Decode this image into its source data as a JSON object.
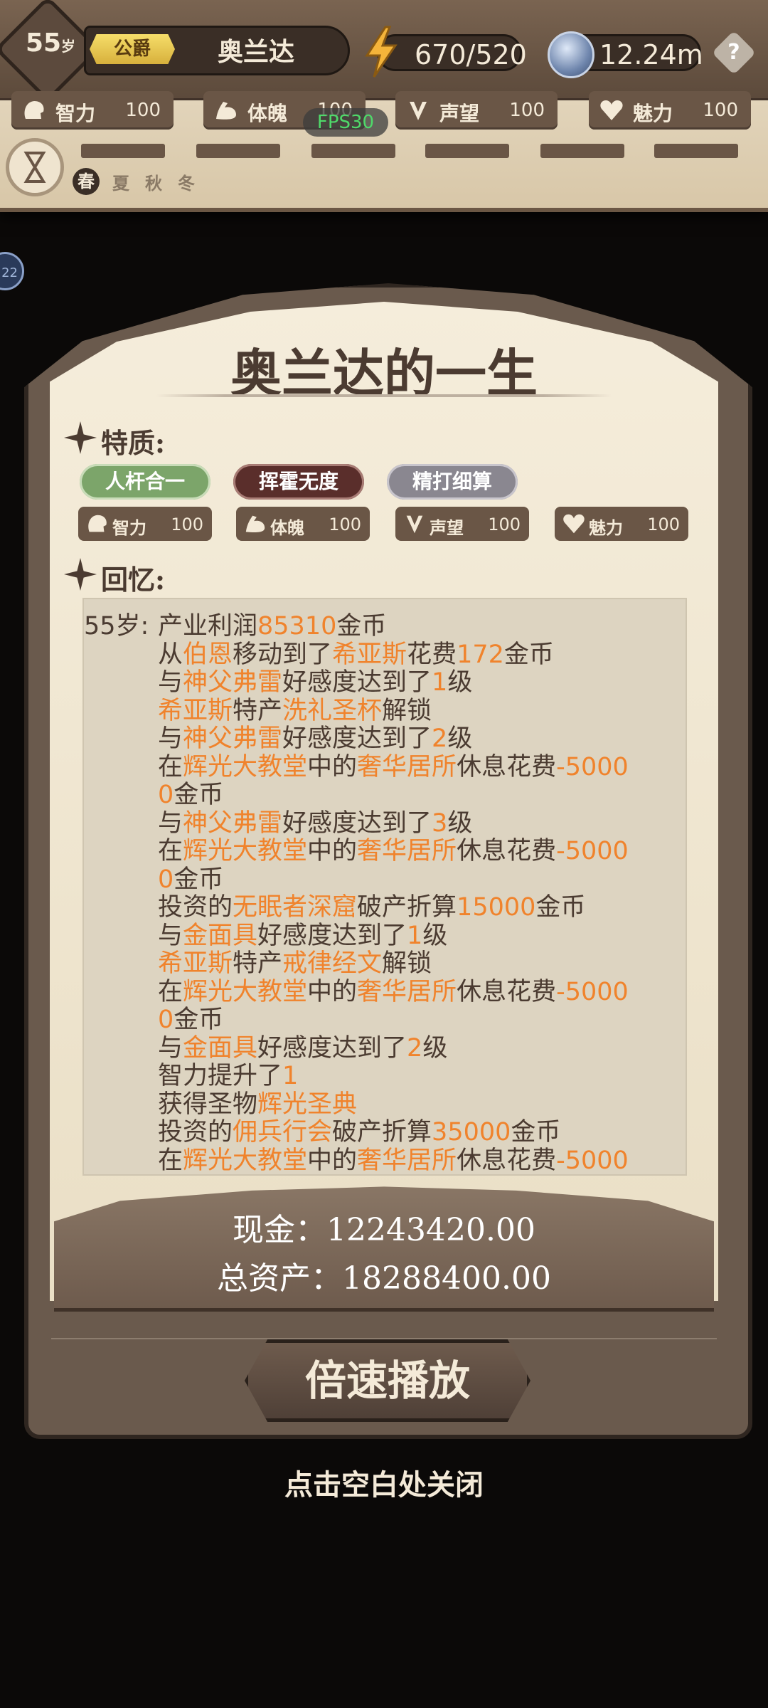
{
  "header": {
    "age": "55",
    "age_unit": "岁",
    "title": "公爵",
    "name": "奥兰达",
    "energy": "670/520",
    "currency": "12.24m",
    "help": "?",
    "fps": "FPS30",
    "stats": [
      {
        "label": "智力",
        "value": "100",
        "icon": "brain-icon"
      },
      {
        "label": "体魄",
        "value": "100",
        "icon": "muscle-icon"
      },
      {
        "label": "声望",
        "value": "100",
        "icon": "laurel-icon"
      },
      {
        "label": "魅力",
        "value": "100",
        "icon": "heart-icon"
      }
    ],
    "seasons": [
      "春",
      "夏",
      "秋",
      "冬"
    ],
    "side_tab": "22"
  },
  "modal": {
    "title": "奥兰达的一生",
    "traits_label": "特质:",
    "traits": [
      {
        "label": "人杆合一",
        "color": "#7ca56a"
      },
      {
        "label": "挥霍无度",
        "color": "#5a2e2b"
      },
      {
        "label": "精打细算",
        "color": "#8a8790"
      }
    ],
    "stats": [
      {
        "label": "智力",
        "value": "100"
      },
      {
        "label": "体魄",
        "value": "100"
      },
      {
        "label": "声望",
        "value": "100"
      },
      {
        "label": "魅力",
        "value": "100"
      }
    ],
    "memories_label": "回忆:",
    "log": [
      {
        "age": "55岁:",
        "parts": [
          [
            "产业利润",
            0
          ],
          [
            "85310",
            1
          ],
          [
            "金币",
            0
          ]
        ]
      },
      {
        "parts": [
          [
            "从",
            0
          ],
          [
            "伯恩",
            1
          ],
          [
            "移动到了",
            0
          ],
          [
            "希亚斯",
            1
          ],
          [
            "花费",
            0
          ],
          [
            "172",
            1
          ],
          [
            "金币",
            0
          ]
        ]
      },
      {
        "parts": [
          [
            "与",
            0
          ],
          [
            "神父弗雷",
            1
          ],
          [
            "好感度达到了",
            0
          ],
          [
            "1",
            1
          ],
          [
            "级",
            0
          ]
        ]
      },
      {
        "parts": [
          [
            "希亚斯",
            1
          ],
          [
            "特产",
            0
          ],
          [
            "洗礼圣杯",
            1
          ],
          [
            "解锁",
            0
          ]
        ]
      },
      {
        "parts": [
          [
            "与",
            0
          ],
          [
            "神父弗雷",
            1
          ],
          [
            "好感度达到了",
            0
          ],
          [
            "2",
            1
          ],
          [
            "级",
            0
          ]
        ]
      },
      {
        "parts": [
          [
            "在",
            0
          ],
          [
            "辉光大教堂",
            1
          ],
          [
            "中的",
            0
          ],
          [
            "奢华居所",
            1
          ],
          [
            "休息花费",
            0
          ],
          [
            "-5000",
            1
          ]
        ]
      },
      {
        "parts": [
          [
            "0",
            1
          ],
          [
            "金币",
            0
          ]
        ]
      },
      {
        "parts": [
          [
            "与",
            0
          ],
          [
            "神父弗雷",
            1
          ],
          [
            "好感度达到了",
            0
          ],
          [
            "3",
            1
          ],
          [
            "级",
            0
          ]
        ]
      },
      {
        "parts": [
          [
            "在",
            0
          ],
          [
            "辉光大教堂",
            1
          ],
          [
            "中的",
            0
          ],
          [
            "奢华居所",
            1
          ],
          [
            "休息花费",
            0
          ],
          [
            "-5000",
            1
          ]
        ]
      },
      {
        "parts": [
          [
            "0",
            1
          ],
          [
            "金币",
            0
          ]
        ]
      },
      {
        "parts": [
          [
            "投资的",
            0
          ],
          [
            "无眠者深窟",
            1
          ],
          [
            "破产折算",
            0
          ],
          [
            "15000",
            1
          ],
          [
            "金币",
            0
          ]
        ]
      },
      {
        "parts": [
          [
            "与",
            0
          ],
          [
            "金面具",
            1
          ],
          [
            "好感度达到了",
            0
          ],
          [
            "1",
            1
          ],
          [
            "级",
            0
          ]
        ]
      },
      {
        "parts": [
          [
            "希亚斯",
            1
          ],
          [
            "特产",
            0
          ],
          [
            "戒律经文",
            1
          ],
          [
            "解锁",
            0
          ]
        ]
      },
      {
        "parts": [
          [
            "在",
            0
          ],
          [
            "辉光大教堂",
            1
          ],
          [
            "中的",
            0
          ],
          [
            "奢华居所",
            1
          ],
          [
            "休息花费",
            0
          ],
          [
            "-5000",
            1
          ]
        ]
      },
      {
        "parts": [
          [
            "0",
            1
          ],
          [
            "金币",
            0
          ]
        ]
      },
      {
        "parts": [
          [
            "与",
            0
          ],
          [
            "金面具",
            1
          ],
          [
            "好感度达到了",
            0
          ],
          [
            "2",
            1
          ],
          [
            "级",
            0
          ]
        ]
      },
      {
        "parts": [
          [
            "智力提升了",
            0
          ],
          [
            "1",
            1
          ]
        ]
      },
      {
        "parts": [
          [
            "获得圣物",
            0
          ],
          [
            "辉光圣典",
            1
          ]
        ]
      },
      {
        "parts": [
          [
            "投资的",
            0
          ],
          [
            "佣兵行会",
            1
          ],
          [
            "破产折算",
            0
          ],
          [
            "35000",
            1
          ],
          [
            "金币",
            0
          ]
        ]
      },
      {
        "parts": [
          [
            "在",
            0
          ],
          [
            "辉光大教堂",
            1
          ],
          [
            "中的",
            0
          ],
          [
            "奢华居所",
            1
          ],
          [
            "休息花费",
            0
          ],
          [
            "-5000",
            1
          ]
        ]
      }
    ],
    "cash": "现金：12243420.00",
    "total_assets": "总资产：18288400.00",
    "speed_button": "倍速播放",
    "close_hint": "点击空白处关闭"
  },
  "colors": {
    "highlight": "#f0832c",
    "text_dark": "#4b3b31"
  }
}
